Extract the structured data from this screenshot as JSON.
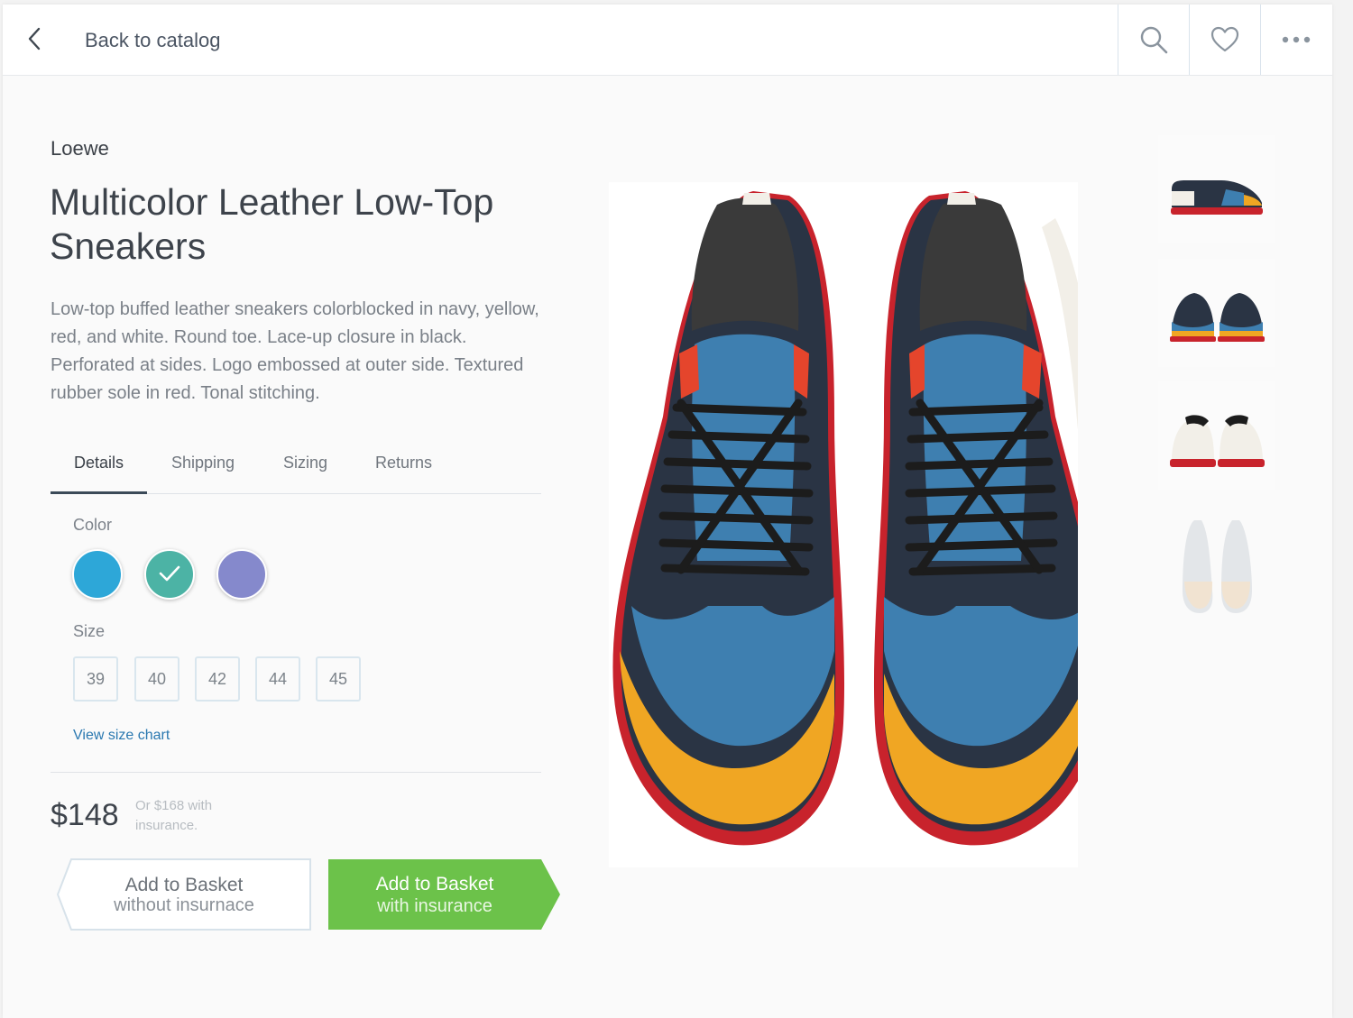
{
  "header": {
    "back_label": "Back to catalog",
    "icons": [
      "chevron-left-icon",
      "search-icon",
      "heart-icon",
      "more-icon"
    ]
  },
  "product": {
    "brand": "Loewe",
    "title": "Multicolor Leather Low-Top Sneakers",
    "description": "Low-top buffed leather sneakers colorblocked in navy, yellow, red, and white. Round toe. Lace-up closure in black. Perforated at sides. Logo embossed at outer side. Textured rubber sole in red. Tonal stitching."
  },
  "tabs": [
    {
      "label": "Details",
      "active": true
    },
    {
      "label": "Shipping",
      "active": false
    },
    {
      "label": "Sizing",
      "active": false
    },
    {
      "label": "Returns",
      "active": false
    }
  ],
  "color": {
    "label": "Color",
    "options": [
      {
        "hex": "#2da7d8",
        "selected": false
      },
      {
        "hex": "#4cb3a5",
        "selected": true
      },
      {
        "hex": "#8589cc",
        "selected": false
      }
    ]
  },
  "size": {
    "label": "Size",
    "options": [
      "39",
      "40",
      "42",
      "44",
      "45"
    ],
    "chart_link": "View size chart"
  },
  "pricing": {
    "price": "$148",
    "insurance_note": "Or $168 with insurance."
  },
  "buttons": {
    "without": {
      "line1": "Add to Basket",
      "line2": "without insurnace"
    },
    "with": {
      "line1": "Add to Basket",
      "line2": "with insurance"
    }
  },
  "colors": {
    "accent_green": "#6cc24a",
    "link_blue": "#2a78b0",
    "sole_red": "#c8232c",
    "upper_blue": "#3e7fb0",
    "toe_yellow": "#f0a623",
    "navy": "#2a3444"
  },
  "thumbnails": [
    "side-view",
    "front-pair-view",
    "back-pair-view",
    "top-view-faded"
  ]
}
